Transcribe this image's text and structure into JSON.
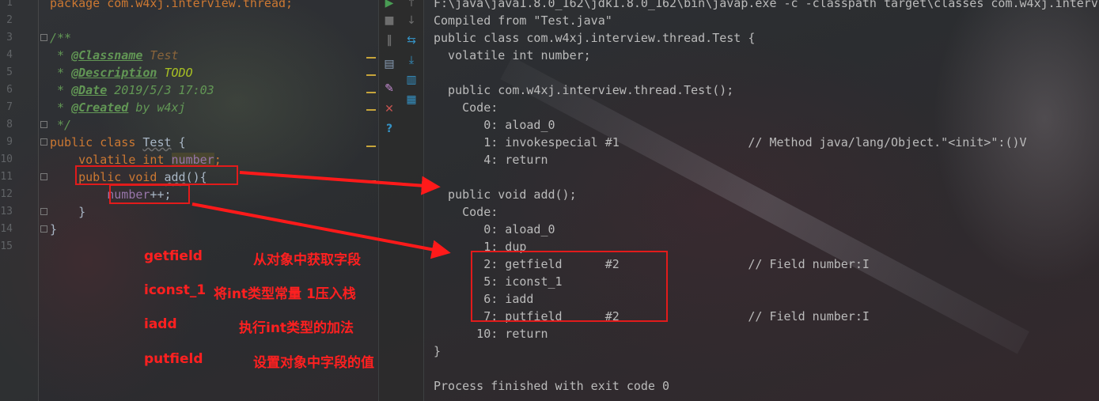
{
  "editor": {
    "line_numbers": [
      "1",
      "2",
      "3",
      "4",
      "5",
      "6",
      "7",
      "8",
      "9",
      "10",
      "11",
      "12",
      "13",
      "14",
      "15"
    ],
    "line1": "package com.w4xj.interview.thread;",
    "doc_open": "/**",
    "star": " * ",
    "tag_classname": "@Classname",
    "val_classname": " Test",
    "tag_description": "@Description",
    "val_description": " TODO",
    "tag_date": "@Date",
    "val_date": " 2019/5/3 17:03",
    "tag_created": "@Created",
    "val_created": " by w4xj",
    "doc_close": " */",
    "kw_public": "public",
    "kw_class": "class",
    "class_name": "Test",
    "brace_open": "{",
    "indent1": "    ",
    "indent2": "        ",
    "kw_volatile": "volatile",
    "kw_int": "int",
    "field_number": "number",
    "semicolon": ";",
    "kw_void": "void",
    "method_add": "add",
    "method_tail": "(){",
    "increment": "++;",
    "brace_close": "}"
  },
  "toolbar": {
    "colors": {
      "green": "#499c54",
      "blue": "#3592c4",
      "red": "#c75450",
      "gray": "#6e6e6e"
    },
    "icons": [
      "run-icon",
      "stop-icon",
      "pause-icon",
      "up-icon",
      "down-icon",
      "layout-icon",
      "wrap-icon",
      "pin-icon",
      "scroll-end-icon",
      "close-icon",
      "print-icon",
      "help-icon",
      "trash-icon"
    ],
    "glyphs": {
      "run": "▶",
      "stop": "■",
      "pause": "‖",
      "up": "↑",
      "down": "↓",
      "layout": "▤",
      "wrap": "⇆",
      "pin": "✎",
      "scroll_end": "⤓",
      "close": "✕",
      "print": "▥",
      "help": "?",
      "trash": "▦"
    }
  },
  "console": {
    "lines": [
      "F:\\java\\java1.8.0_162\\jdk1.8.0_162\\bin\\javap.exe -c -classpath target\\classes com.w4xj.interview.thread.Test",
      "Compiled from \"Test.java\"",
      "public class com.w4xj.interview.thread.Test {",
      "  volatile int number;",
      "",
      "  public com.w4xj.interview.thread.Test();",
      "    Code:",
      "       0: aload_0",
      "       1: invokespecial #1                  // Method java/lang/Object.\"<init>\":()V",
      "       4: return",
      "",
      "  public void add();",
      "    Code:",
      "       0: aload_0",
      "       1: dup",
      "       2: getfield      #2                  // Field number:I",
      "       5: iconst_1",
      "       6: iadd",
      "       7: putfield      #2                  // Field number:I",
      "      10: return",
      "}",
      "",
      "Process finished with exit code 0"
    ]
  },
  "annotations": {
    "getfield": {
      "op": "getfield",
      "desc": "从对象中获取字段"
    },
    "iconst": {
      "op": "iconst_1",
      "desc": "将int类型常量 1压入栈"
    },
    "iadd": {
      "op": "iadd",
      "desc": "执行int类型的加法"
    },
    "putfield": {
      "op": "putfield",
      "desc": "设置对象中字段的值"
    },
    "color": "#ff2020"
  }
}
